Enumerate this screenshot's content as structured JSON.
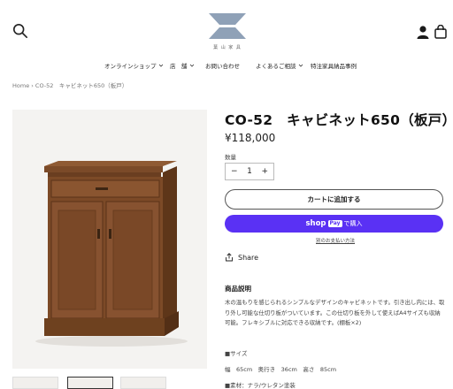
{
  "header": {
    "logo_text": "葉 山 家 具",
    "icons": [
      "search-icon",
      "account-icon",
      "cart-icon"
    ]
  },
  "nav": {
    "items": [
      {
        "label": "オンラインショップ",
        "has_dropdown": true
      },
      {
        "label": "店　舗",
        "has_dropdown": true
      },
      {
        "label": "お問い合わせ",
        "has_dropdown": false
      },
      {
        "label": "よくあるご相談",
        "has_dropdown": true
      },
      {
        "label": "特注家具納品事例",
        "has_dropdown": false
      }
    ]
  },
  "breadcrumb": "Home › CO-52　キャビネット650（板戸）",
  "product": {
    "title": "CO-52　キャビネット650（板戸）",
    "price": "¥118,000",
    "quantity_label": "数量",
    "quantity": "1",
    "minus": "−",
    "plus": "+",
    "add_to_cart": "カートに追加する",
    "shoppay_brand": "shop",
    "shoppay_pay": "Pay",
    "shoppay_action": "で購入",
    "more_payment": "別のお支払い方法",
    "share": "Share"
  },
  "description": {
    "heading": "商品説明",
    "paragraph": "木の温もりを感じられるシンプルなデザインのキャビネットです。引き出し内には、取り外し可能な仕切り板がついています。この仕切り板を外して使えばA4サイズも収納可能。フレキシブルに対応できる収納です。(棚板×2)",
    "size_heading": "■サイズ",
    "size_values": "幅　65cm　奥行き　36cm　高さ　85cm",
    "material": "■素材：ナラ/ウレタン塗装"
  },
  "colors": {
    "accent_purple": "#5a31f4",
    "wood": "#7a4a28"
  }
}
